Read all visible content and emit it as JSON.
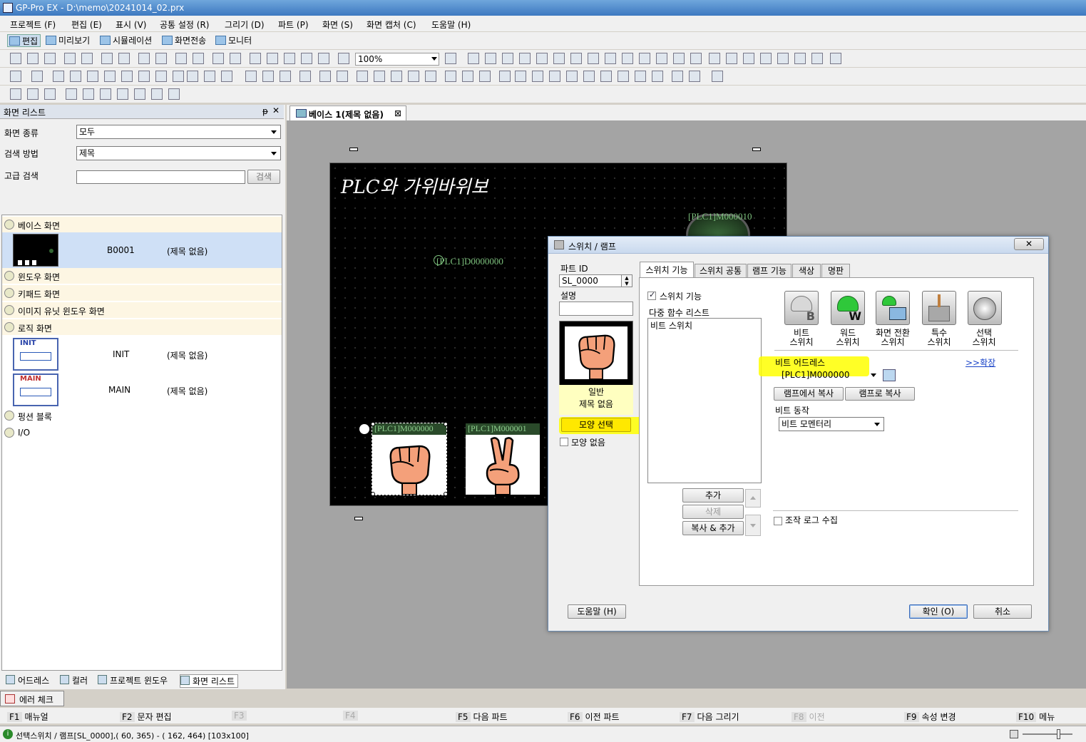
{
  "app": {
    "title": "GP-Pro EX - D:\\memo\\20241014_02.prx"
  },
  "menu": [
    "프로젝트 (F)",
    "편집 (E)",
    "표시 (V)",
    "공통 설정 (R)",
    "그리기 (D)",
    "파트 (P)",
    "화면 (S)",
    "화면 캡처 (C)",
    "도움말 (H)"
  ],
  "modes": [
    "편집",
    "미리보기",
    "시뮬레이션",
    "화면전송",
    "모니터"
  ],
  "toolbar": {
    "zoom": "100%"
  },
  "screen_list": {
    "title": "화면 리스트",
    "pin": "ᵽ",
    "close": "✕",
    "type_label": "화면 종류",
    "type_value": "모두",
    "method_label": "검색 방법",
    "method_value": "제목",
    "advanced_label": "고급 검색",
    "search_button": "검색",
    "groups": {
      "base": "베이스 화면",
      "window": "윈도우 화면",
      "keypad": "키패드 화면",
      "image_unit": "이미지 유닛 윈도우 화면",
      "logic": "로직 화면",
      "function_block": "펑션 블록",
      "io": "I/O"
    },
    "base_item": {
      "id": "B0001",
      "title": "(제목 없음)"
    },
    "logic_items": [
      {
        "thumb": "INIT",
        "id": "INIT",
        "title": "(제목 없음)"
      },
      {
        "thumb": "MAIN",
        "id": "MAIN",
        "title": "(제목 없음)"
      }
    ]
  },
  "bottom_tabs": [
    "어드레스",
    "컬러",
    "프로젝트 윈도우",
    "화면 리스트"
  ],
  "error_tab": "에러 체크",
  "fkeys": [
    {
      "key": "F1",
      "label": "매뉴얼",
      "enabled": true
    },
    {
      "key": "F2",
      "label": "문자 편집",
      "enabled": true
    },
    {
      "key": "F3",
      "label": "",
      "enabled": false
    },
    {
      "key": "F4",
      "label": "",
      "enabled": false
    },
    {
      "key": "F5",
      "label": "다음 파트",
      "enabled": true
    },
    {
      "key": "F6",
      "label": "이전 파트",
      "enabled": true
    },
    {
      "key": "F7",
      "label": "다음 그리기",
      "enabled": true
    },
    {
      "key": "F8",
      "label": "이전",
      "enabled": false
    },
    {
      "key": "F9",
      "label": "속성 변경",
      "enabled": true
    },
    {
      "key": "F10",
      "label": "메뉴",
      "enabled": true
    }
  ],
  "status": {
    "text": "선택스위치 / 램프[SL_0000],( 60, 365) - ( 162, 464) [103x100]"
  },
  "editor": {
    "tab": "베이스 1(제목 없음)",
    "tab_close": "⊠",
    "screen_title": "PLC와 가위바위보",
    "labels": {
      "lamp": "[PLC1]M000010",
      "display": "[PLC1]D0000000",
      "switch_rock": "[PLC1]M000000",
      "switch_scissors": "[PLC1]M000001"
    }
  },
  "dialog": {
    "title": "스위치 / 램프",
    "close": "✕",
    "part_id_label": "파트 ID",
    "part_id": "SL_0000",
    "desc_label": "설명",
    "desc_value": "",
    "preview_line1": "일반",
    "preview_line2": "제목 없음",
    "shape_select": "모양 선택",
    "no_shape": "모양 없음",
    "tabs": [
      "스위치 기능",
      "스위치 공통",
      "램프 기능",
      "색상",
      "명판"
    ],
    "switch_function_check": "스위치 기능",
    "multi_list_label": "다중 함수 리스트",
    "multi_list_items": [
      "비트 스위치"
    ],
    "switch_types": [
      {
        "line1": "비트",
        "line2": "스위치",
        "glyph": "B"
      },
      {
        "line1": "워드",
        "line2": "스위치",
        "glyph": "W"
      },
      {
        "line1": "화면 전환",
        "line2": "스위치",
        "glyph": ""
      },
      {
        "line1": "특수",
        "line2": "스위치",
        "glyph": ""
      },
      {
        "line1": "선택",
        "line2": "스위치",
        "glyph": ""
      }
    ],
    "bit_address_label": "비트 어드레스",
    "expand_link": ">>확장",
    "bit_address": "[PLC1]M000000",
    "copy_from_lamp": "램프에서 복사",
    "copy_to_lamp": "램프로 복사",
    "bit_action_label": "비트 동작",
    "bit_action": "비트 모멘터리",
    "add_button": "추가",
    "delete_button": "삭제",
    "copy_add_button": "복사 & 추가",
    "log_check": "조작 로그 수집",
    "help_button": "도움말 (H)",
    "ok_button": "확인 (O)",
    "cancel_button": "취소"
  },
  "colors": {
    "highlight": "#ffff00",
    "label_green": "#7ec27e"
  }
}
